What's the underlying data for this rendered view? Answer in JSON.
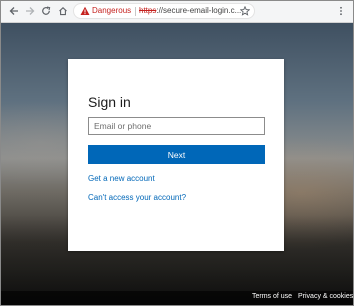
{
  "browser": {
    "back_icon": "arrow-left-icon",
    "forward_icon": "arrow-right-icon",
    "reload_icon": "reload-icon",
    "home_icon": "home-icon",
    "security_icon": "warning-triangle-icon",
    "security_label": "Dangerous",
    "url_scheme": "https",
    "url_rest": "://secure-email-login.c...",
    "star_icon": "star-icon",
    "menu_icon": "kebab-menu-icon",
    "danger_color": "#c5221f"
  },
  "login": {
    "title": "Sign in",
    "email_placeholder": "Email or phone",
    "email_value": "",
    "next_label": "Next",
    "new_account_link": "Get a new account",
    "cant_access_link": "Can't access your account?",
    "accent_color": "#0067b8"
  },
  "footer": {
    "terms_label": "Terms of use",
    "privacy_label": "Privacy & cookies"
  }
}
